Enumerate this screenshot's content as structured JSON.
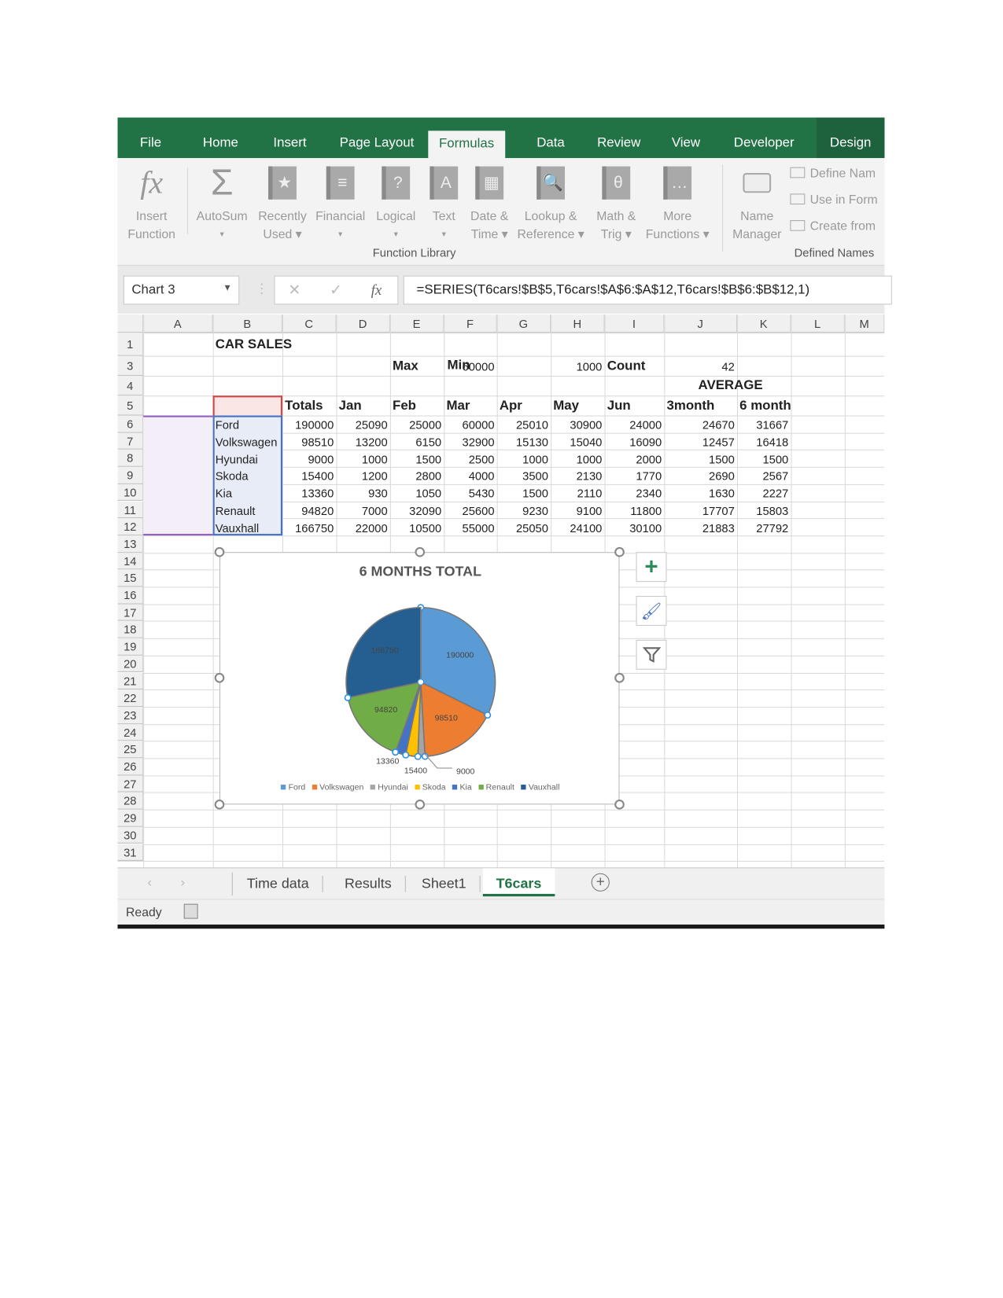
{
  "ribbon_tabs": [
    "File",
    "Home",
    "Insert",
    "Page Layout",
    "Formulas",
    "Data",
    "Review",
    "View",
    "Developer",
    "Design"
  ],
  "active_tab": "Formulas",
  "function_library": {
    "buttons": [
      {
        "line1": "Insert",
        "line2": "Function",
        "icon": "fx-icon"
      },
      {
        "line1": "AutoSum",
        "line2": "▾",
        "icon": "sigma-icon"
      },
      {
        "line1": "Recently",
        "line2": "Used ▾",
        "icon": "star-book-icon"
      },
      {
        "line1": "Financial",
        "line2": "▾",
        "icon": "financial-book-icon"
      },
      {
        "line1": "Logical",
        "line2": "▾",
        "icon": "question-book-icon"
      },
      {
        "line1": "Text",
        "line2": "▾",
        "icon": "text-book-icon"
      },
      {
        "line1": "Date &",
        "line2": "Time ▾",
        "icon": "calendar-book-icon"
      },
      {
        "line1": "Lookup &",
        "line2": "Reference ▾",
        "icon": "lookup-book-icon"
      },
      {
        "line1": "Math &",
        "line2": "Trig ▾",
        "icon": "theta-book-icon"
      },
      {
        "line1": "More",
        "line2": "Functions ▾",
        "icon": "more-book-icon"
      }
    ],
    "label": "Function Library"
  },
  "defined_names": {
    "name_manager": {
      "line1": "Name",
      "line2": "Manager"
    },
    "items": [
      "Define Nam",
      "Use in Form",
      "Create from"
    ],
    "label": "Defined Names"
  },
  "formula_bar": {
    "name_box": "Chart 3",
    "formula": "=SERIES(T6cars!$B$5,T6cars!$A$6:$A$12,T6cars!$B$6:$B$12,1)"
  },
  "columns": [
    "A",
    "B",
    "C",
    "D",
    "E",
    "F",
    "G",
    "H",
    "I",
    "J",
    "K",
    "L",
    "M"
  ],
  "row_numbers": [
    "1",
    "3",
    "4",
    "5",
    "6",
    "7",
    "8",
    "9",
    "10",
    "11",
    "12",
    "13",
    "14",
    "15",
    "16",
    "17",
    "18",
    "19",
    "20",
    "21",
    "22",
    "23",
    "24",
    "25",
    "26",
    "27",
    "28",
    "29",
    "30",
    "31"
  ],
  "sheet": {
    "title": "CAR SALES",
    "row3": {
      "max_label": "Max",
      "max": "60000",
      "min_label": "Min",
      "min": "1000",
      "count_label": "Count",
      "count": "42"
    },
    "average_label": "AVERAGE",
    "headers": [
      "",
      "Totals",
      "Jan",
      "Feb",
      "Mar",
      "Apr",
      "May",
      "Jun",
      "3month",
      "6 month"
    ],
    "rows": [
      [
        "Ford",
        "190000",
        "25090",
        "25000",
        "60000",
        "25010",
        "30900",
        "24000",
        "24670",
        "31667"
      ],
      [
        "Volkswagen",
        "98510",
        "13200",
        "6150",
        "32900",
        "15130",
        "15040",
        "16090",
        "12457",
        "16418"
      ],
      [
        "Hyundai",
        "9000",
        "1000",
        "1500",
        "2500",
        "1000",
        "1000",
        "2000",
        "1500",
        "1500"
      ],
      [
        "Skoda",
        "15400",
        "1200",
        "2800",
        "4000",
        "3500",
        "2130",
        "1770",
        "2690",
        "2567"
      ],
      [
        "Kia",
        "13360",
        "930",
        "1050",
        "5430",
        "1500",
        "2110",
        "2340",
        "1630",
        "2227"
      ],
      [
        "Renault",
        "94820",
        "7000",
        "32090",
        "25600",
        "9230",
        "9100",
        "11800",
        "17707",
        "15803"
      ],
      [
        "Vauxhall",
        "166750",
        "22000",
        "10500",
        "55000",
        "25050",
        "24100",
        "30100",
        "21883",
        "27792"
      ]
    ]
  },
  "chart_data": {
    "type": "pie",
    "title": "6 MONTHS TOTAL",
    "categories": [
      "Ford",
      "Volkswagen",
      "Hyundai",
      "Skoda",
      "Kia",
      "Renault",
      "Vauxhall"
    ],
    "values": [
      190000,
      98510,
      9000,
      15400,
      13360,
      94820,
      166750
    ],
    "data_labels": [
      "190000",
      "98510",
      "9000",
      "15400",
      "13360",
      "94820",
      "166750"
    ],
    "colors": [
      "#5b9bd5",
      "#ed7d31",
      "#a5a5a5",
      "#ffc000",
      "#4472c4",
      "#70ad47",
      "#255e91"
    ],
    "legend_position": "bottom"
  },
  "chart_side_buttons": [
    "plus-icon",
    "brush-icon",
    "filter-icon"
  ],
  "sheet_tabs": [
    "Time data",
    "Results",
    "Sheet1",
    "T6cars"
  ],
  "active_sheet": "T6cars",
  "status": "Ready",
  "colors": {
    "excel_green": "#217346",
    "selection_blue": "#4472c4",
    "header_red": "#c0392b"
  }
}
